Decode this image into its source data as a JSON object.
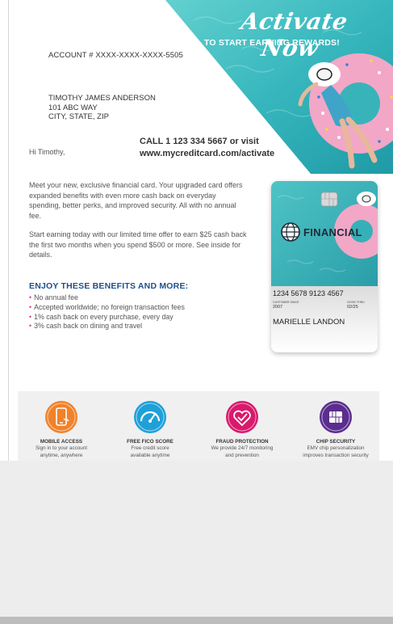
{
  "banner": {
    "title": "Activate Now",
    "subtitle": "TO START EARNING REWARDS!"
  },
  "account": {
    "number": "ACCOUNT # XXXX-XXXX-XXXX-5505"
  },
  "address": {
    "name": "TIMOTHY JAMES ANDERSON",
    "street": "101 ABC WAY",
    "city": "CITY, STATE, ZIP"
  },
  "greeting": "Hi Timothy,",
  "call": {
    "line1": "CALL 1 123 334 5667 or visit",
    "line2": "www.mycreditcard.com/activate"
  },
  "body": {
    "para1": "Meet your new, exclusive financial card. Your upgraded card offers expanded benefits with even more cash back on everyday spending, better perks, and improved security. All with no annual fee.",
    "para2": "Start earning today with our limited time offer to earn $25 cash back the first two months when you spend $500 or more. See inside for details."
  },
  "benefits": {
    "heading": "ENJOY THESE BENEFITS AND MORE:",
    "items": [
      "No annual fee",
      "Accepted worldwide; no foreign transaction fees",
      "1% cash back on every purchase, every day",
      "3% cash back on dining and travel"
    ]
  },
  "card": {
    "brand": "FINANCIAL",
    "number": "1234 5678 9123 4567",
    "customer_since_label": "CUSTOMER SINCE",
    "customer_since": "2007",
    "good_thru_label": "GOOD THRU",
    "good_thru": "02/25",
    "holder": "MARIELLE LANDON"
  },
  "features": [
    {
      "icon": "mobile-phone-icon",
      "color": "#f0822b",
      "title": "MOBILE ACCESS",
      "line1": "Sign in to your account",
      "line2": "anytime, anywhere"
    },
    {
      "icon": "gauge-icon",
      "color": "#1fa0d8",
      "title": "FREE FICO SCORE",
      "line1": "Free credit score",
      "line2": "available anytime"
    },
    {
      "icon": "heart-check-icon",
      "color": "#d9196c",
      "title": "FRAUD PROTECTION",
      "line1": "We provide 24/7 monitoring",
      "line2": "and prevention"
    },
    {
      "icon": "chip-icon",
      "color": "#5b2d8e",
      "title": "CHIP SECURITY",
      "line1": "EMV chip personalization",
      "line2": "improves transaction security"
    }
  ],
  "colors": {
    "accent_blue": "#1e4f8c",
    "bullet_pink": "#d33f8a",
    "pool_teal": "#3fbcc0"
  }
}
